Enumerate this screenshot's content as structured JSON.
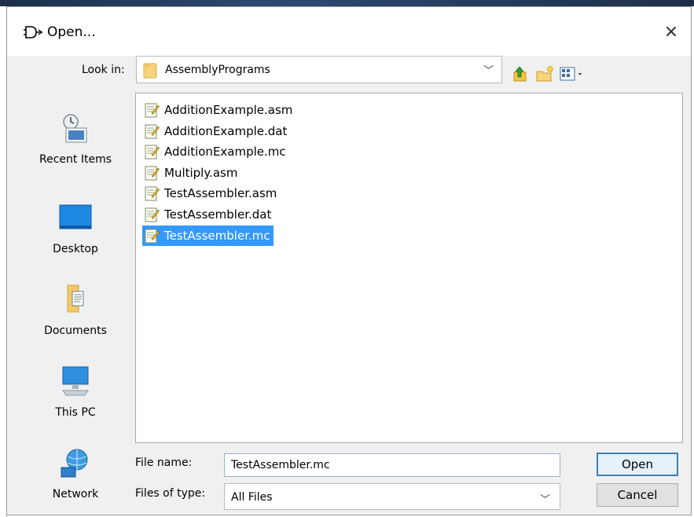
{
  "dialog": {
    "title": "Open...",
    "close_glyph": "×"
  },
  "look_in": {
    "label": "Look in:",
    "value": "AssemblyPrograms",
    "arrow": "﹀"
  },
  "toolbar": {
    "icons": [
      "up-one-level-icon",
      "create-new-folder-icon",
      "view-menu-icon"
    ]
  },
  "places": [
    {
      "label": "Recent Items",
      "icon": "recent-items-icon"
    },
    {
      "label": "Desktop",
      "icon": "desktop-icon"
    },
    {
      "label": "Documents",
      "icon": "documents-icon"
    },
    {
      "label": "This PC",
      "icon": "this-pc-icon"
    },
    {
      "label": "Network",
      "icon": "network-icon"
    }
  ],
  "files": [
    {
      "name": "AdditionExample.asm",
      "selected": false
    },
    {
      "name": "AdditionExample.dat",
      "selected": false
    },
    {
      "name": "AdditionExample.mc",
      "selected": false
    },
    {
      "name": "Multiply.asm",
      "selected": false
    },
    {
      "name": "TestAssembler.asm",
      "selected": false
    },
    {
      "name": "TestAssembler.dat",
      "selected": false
    },
    {
      "name": "TestAssembler.mc",
      "selected": true
    }
  ],
  "file_name": {
    "label": "File name:",
    "value": "TestAssembler.mc"
  },
  "file_type": {
    "label": "Files of type:",
    "value": "All Files",
    "arrow": "﹀"
  },
  "buttons": {
    "open": "Open",
    "cancel": "Cancel"
  },
  "colors": {
    "selection": "#3399ff",
    "dialog_bg": "#f0f0f0",
    "list_bg": "#ffffff"
  }
}
